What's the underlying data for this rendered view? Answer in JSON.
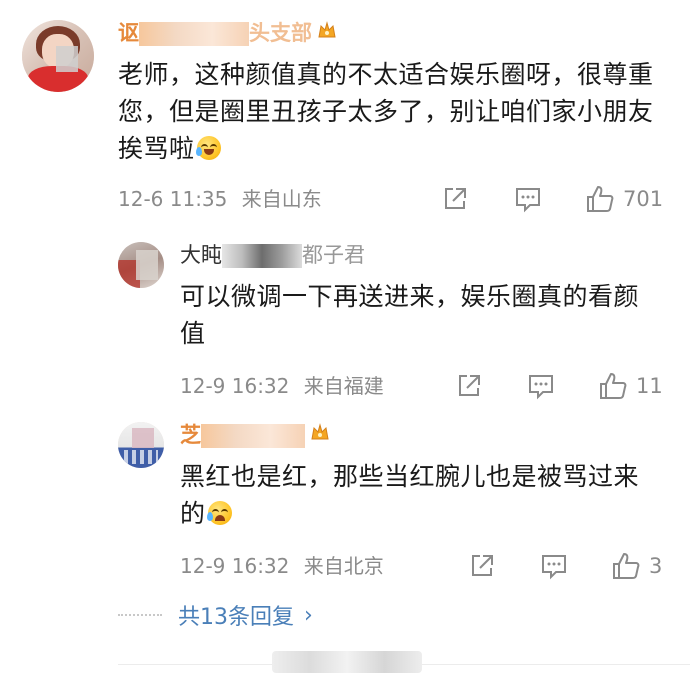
{
  "comments": [
    {
      "name_visible": "讴",
      "name_tail": "头支部",
      "text": "老师，这种颜值真的不太适合娱乐圈呀，很尊重您，但是圈里丑孩子太多了，别让咱们家小朋友挨骂啦",
      "time": "12-6 11:35",
      "location": "来自山东",
      "likes": "701"
    },
    {
      "name_visible": "大盹",
      "name_tail": "都子君",
      "text": "可以微调一下再送进来，娱乐圈真的看颜值",
      "time": "12-9 16:32",
      "location": "来自福建",
      "likes": "11"
    },
    {
      "name_visible": "芝",
      "name_tail": "",
      "text": "黑红也是红，那些当红腕儿也是被骂过来的",
      "time": "12-9 16:32",
      "location": "来自北京",
      "likes": "3"
    }
  ],
  "more_replies": {
    "label": "共13条回复",
    "arrow": "›"
  },
  "icons": {
    "share": "share-icon",
    "comment": "comment-icon",
    "like": "like-icon",
    "badge": "crown-badge-icon",
    "emoji_laugh": "laugh-cry-emoji-icon",
    "emoji_cry": "crying-emoji-icon"
  },
  "colors": {
    "username_highlight": "#e6893b",
    "link": "#4a7fb8",
    "meta": "#8a8a8a"
  }
}
